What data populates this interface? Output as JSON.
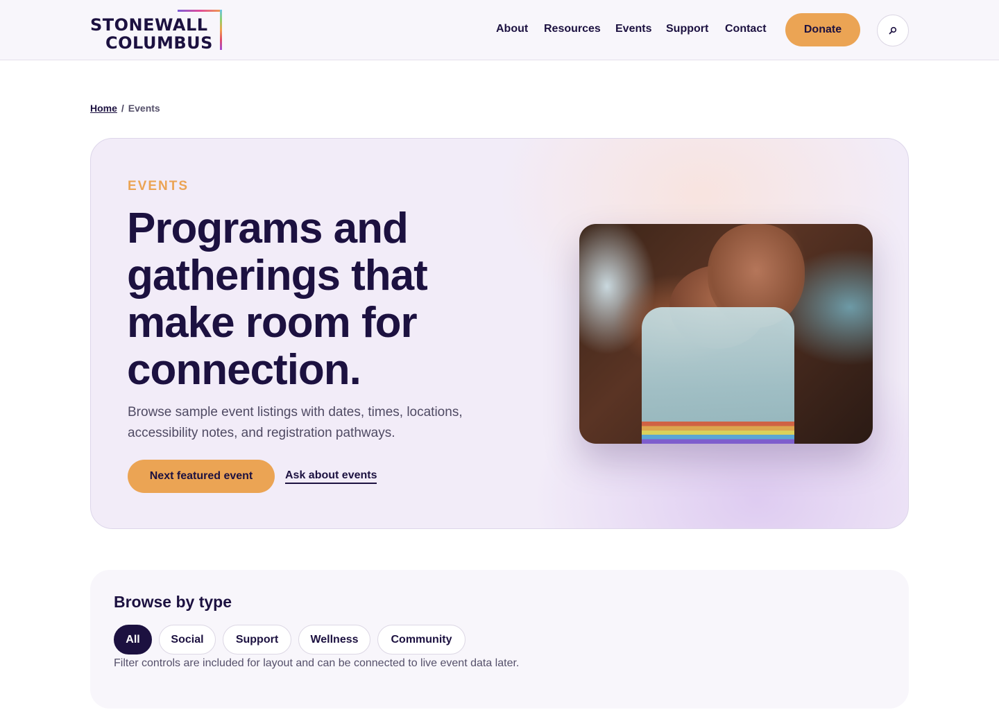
{
  "brand": {
    "line1": "STONEWALL",
    "line2": "COLUMBUS"
  },
  "nav": {
    "items": [
      {
        "label": "About"
      },
      {
        "label": "Resources"
      },
      {
        "label": "Events"
      },
      {
        "label": "Support"
      },
      {
        "label": "Contact"
      }
    ],
    "donate_label": "Donate",
    "search_icon": "search-icon"
  },
  "breadcrumb": {
    "home": "Home",
    "separator": "/",
    "current": "Events"
  },
  "hero": {
    "eyebrow": "EVENTS",
    "title": "Programs and gatherings that make room for connection.",
    "description": "Browse sample event listings with dates, times, locations, accessibility notes, and registration pathways.",
    "primary_cta": "Next featured event",
    "secondary_cta": "Ask about events"
  },
  "browse": {
    "title": "Browse by type",
    "chips": [
      {
        "label": "All",
        "active": true
      },
      {
        "label": "Social",
        "active": false
      },
      {
        "label": "Support",
        "active": false
      },
      {
        "label": "Wellness",
        "active": false
      },
      {
        "label": "Community",
        "active": false
      }
    ],
    "note": "Filter controls are included for layout and can be connected to live event data later."
  },
  "colors": {
    "brand_dark": "#1c1140",
    "accent_orange": "#eba454",
    "hero_bg": "#f2ecf8",
    "header_bg": "#f8f6fb"
  }
}
